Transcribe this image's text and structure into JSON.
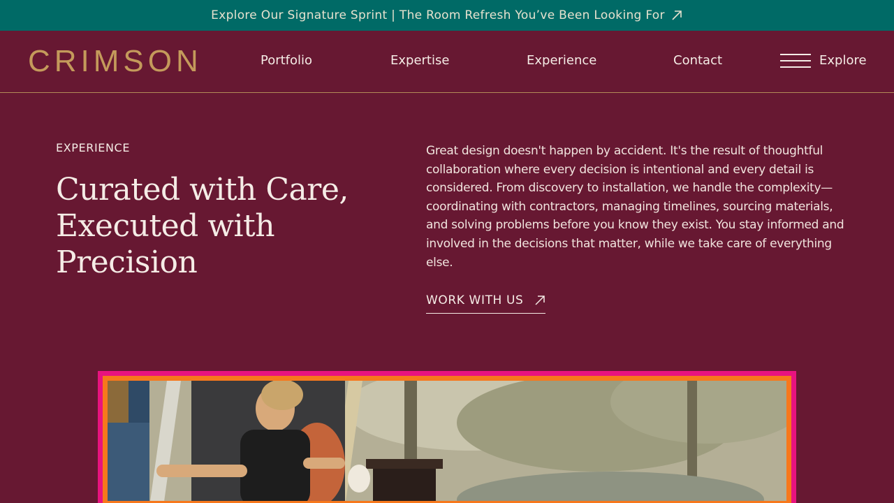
{
  "announcement": {
    "text": "Explore Our Signature Sprint | The Room Refresh You’ve Been Looking For",
    "icon": "arrow-up-right-icon"
  },
  "header": {
    "logo": "CRIMSON",
    "nav": [
      "Portfolio",
      "Expertise",
      "Experience",
      "Contact"
    ],
    "explore_label": "Explore",
    "menu_icon": "hamburger-menu-icon"
  },
  "main": {
    "eyebrow": "EXPERIENCE",
    "headline": "Curated with Care, Executed with Precision",
    "body": "Great design doesn't happen by accident. It's the result of thoughtful collaboration where every decision is intentional and every detail is considered. From discovery to installation, we handle the complexity—coordinating with contractors, managing timelines, sourcing materials, and solving problems before you know they exist. You stay informed and involved in the decisions that matter, while we take care of everything else.",
    "cta_label": "WORK WITH US",
    "cta_icon": "arrow-up-right-icon"
  },
  "colors": {
    "background": "#671832",
    "announcement_bg": "#006a66",
    "logo_gold": "#c49a5b",
    "frame_outer": "#e8137f",
    "frame_inner": "#f7781c"
  }
}
